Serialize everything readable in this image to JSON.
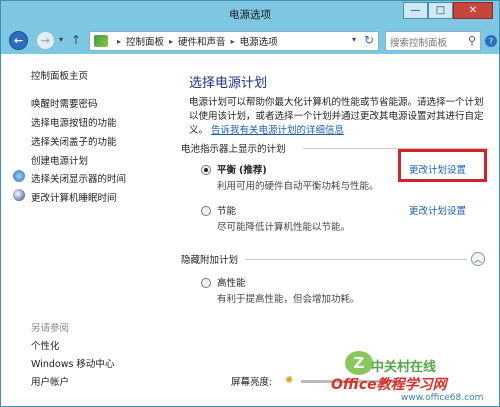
{
  "window": {
    "title": "电源选项",
    "buttons": {
      "minimize": "—",
      "maximize": "□",
      "close": "✕"
    }
  },
  "address": {
    "crumbs": [
      "控制面板",
      "硬件和声音",
      "电源选项"
    ],
    "search_placeholder": "搜索控制面板"
  },
  "sidebar": {
    "home": "控制面板主页",
    "links": [
      "唤醒时需要密码",
      "选择电源按钮的功能",
      "选择关闭盖子的功能",
      "创建电源计划",
      "选择关闭显示器的时间",
      "更改计算机睡眠时间"
    ],
    "also_label": "另请参阅",
    "also_links": [
      "个性化",
      "Windows 移动中心",
      "用户帐户"
    ]
  },
  "main": {
    "heading": "选择电源计划",
    "desc": "电源计划可以帮助你最大化计算机的性能或节省能源。请选择一个计划以使用该计划，或者选择一个计划并通过更改其电源设置对其进行自定义。",
    "desc_link": "告诉我有关电源计划的详细信息",
    "group_label": "电池指示器上显示的计划",
    "plans": [
      {
        "name": "平衡",
        "tag": "(推荐)",
        "desc": "利用可用的硬件自动平衡功耗与性能。",
        "change": "更改计划设置",
        "selected": true
      },
      {
        "name": "节能",
        "tag": "",
        "desc": "尽可能降低计算机性能以节能。",
        "change": "更改计划设置",
        "selected": false
      }
    ],
    "hidden_label": "隐藏附加计划",
    "hidden_plans": [
      {
        "name": "高性能",
        "desc": "有利于提高性能，但会增加功耗。",
        "selected": false
      }
    ],
    "brightness_label": "屏幕亮度:"
  },
  "watermark": {
    "brand": "中关村在线",
    "site": "Office教程学习网",
    "url": "www.office68.com",
    "logo": "Z"
  },
  "colors": {
    "titlebar": "#7dc7e3",
    "link": "#1a5fb4",
    "heading": "#1e3287",
    "highlight": "#d2232b"
  }
}
